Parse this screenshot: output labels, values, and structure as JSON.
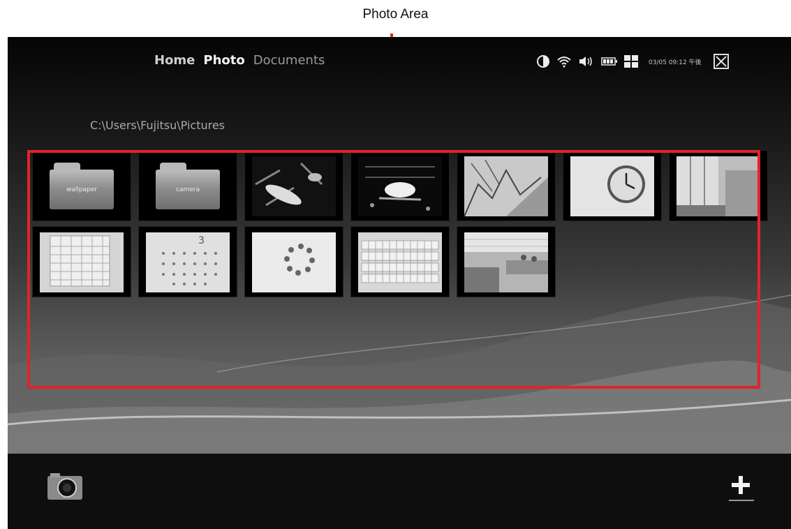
{
  "callout": {
    "title": "Photo Area"
  },
  "nav": {
    "home": "Home",
    "photo": "Photo",
    "documents": "Documents"
  },
  "path": "C:\\Users\\Fujitsu\\Pictures",
  "status": {
    "datetime": "03/05 09:12 午後"
  },
  "folders": [
    {
      "label": "wallpaper"
    },
    {
      "label": "camera"
    }
  ],
  "photos": [
    "fish-photo",
    "splash-photo",
    "tree-photo",
    "clock-photo",
    "window-photo",
    "calendar-board-photo",
    "calendar-photo",
    "circle-objects-photo",
    "keyboard-photo",
    "office-photo"
  ],
  "colors": {
    "frame": "#e2232a",
    "background": "#0d0d0d"
  },
  "icons": {
    "status": [
      "brightness-icon",
      "wifi-icon",
      "volume-icon",
      "battery-icon",
      "grid-icon",
      "close-icon"
    ],
    "bottom": [
      "camera-icon",
      "plus-icon"
    ]
  }
}
